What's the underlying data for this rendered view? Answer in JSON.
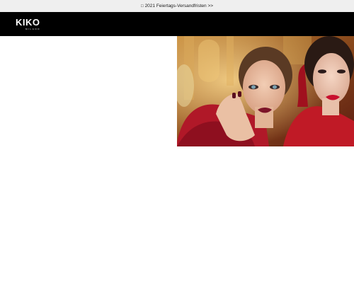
{
  "promo": {
    "icon": "gift-icon",
    "text": "2021 Feiertags-Versandfristen >>"
  },
  "header": {
    "logo_text": "KIKO",
    "logo_subtext": "MILANO",
    "background_color": "#000000"
  },
  "colors": {
    "promo_background": "#efefef",
    "header_background": "#000000",
    "accent_red": "#b01828"
  },
  "hero": {
    "image": "holiday-campaign-two-models-red-dresses"
  }
}
